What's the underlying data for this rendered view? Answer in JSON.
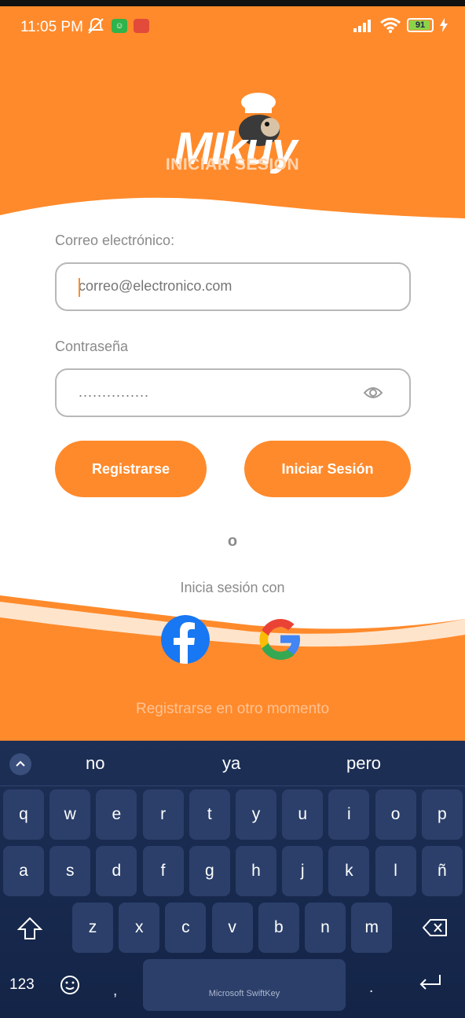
{
  "status": {
    "time": "11:05 PM",
    "battery": "91"
  },
  "app": {
    "logo_text": "MIkuy",
    "title": "INICIAR SESION",
    "email_label": "Correo electrónico:",
    "email_placeholder": "correo@electronico.com",
    "password_label": "Contraseña",
    "password_value": "...............",
    "register_button": "Registrarse",
    "login_button": "Iniciar Sesión",
    "or_text": "o",
    "social_text": "Inicia sesión con",
    "later_link": "Registrarse en otro momento",
    "accent_color": "#ff8a2b"
  },
  "keyboard": {
    "suggestions": [
      "no",
      "ya",
      "pero"
    ],
    "row1": [
      "q",
      "w",
      "e",
      "r",
      "t",
      "y",
      "u",
      "i",
      "o",
      "p"
    ],
    "row2": [
      "a",
      "s",
      "d",
      "f",
      "g",
      "h",
      "j",
      "k",
      "l",
      "ñ"
    ],
    "row3": [
      "z",
      "x",
      "c",
      "v",
      "b",
      "n",
      "m"
    ],
    "numbers_key": "123",
    "comma_key": ",",
    "period_key": ".",
    "space_label": "Microsoft SwiftKey"
  }
}
